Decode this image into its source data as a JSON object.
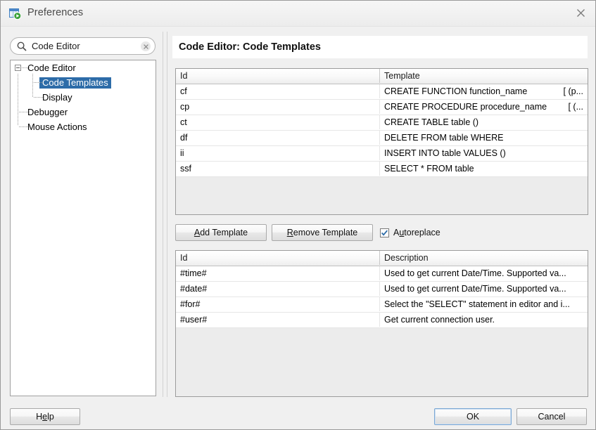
{
  "window": {
    "title": "Preferences",
    "icon": "table-run-icon",
    "close_label": "Close"
  },
  "sidebar": {
    "search": {
      "value": "Code Editor",
      "placeholder": "Search",
      "icon": "search-icon",
      "clear_icon": "clear-icon"
    },
    "tree": [
      {
        "label": "Code Editor",
        "level": 0,
        "expanded": true,
        "selected": false
      },
      {
        "label": "Code Templates",
        "level": 1,
        "expanded": false,
        "selected": true
      },
      {
        "label": "Display",
        "level": 1,
        "expanded": false,
        "selected": false
      },
      {
        "label": "Debugger",
        "level": 0,
        "expanded": false,
        "selected": false
      },
      {
        "label": "Mouse Actions",
        "level": 0,
        "expanded": false,
        "selected": false
      }
    ]
  },
  "main": {
    "heading": "Code Editor: Code Templates",
    "templates_table": {
      "columns": [
        "Id",
        "Template"
      ],
      "rows": [
        {
          "id": "cf",
          "template": "CREATE FUNCTION function_name",
          "tail": "[ (p..."
        },
        {
          "id": "cp",
          "template": "CREATE PROCEDURE procedure_name",
          "tail": "[ (..."
        },
        {
          "id": "ct",
          "template": "CREATE TABLE table ()",
          "tail": ""
        },
        {
          "id": "df",
          "template": "DELETE FROM table WHERE",
          "tail": ""
        },
        {
          "id": "ii",
          "template": "INSERT INTO table VALUES ()",
          "tail": ""
        },
        {
          "id": "ssf",
          "template": "SELECT * FROM table",
          "tail": ""
        }
      ]
    },
    "actions": {
      "add_template": {
        "pre": "",
        "mnemonic": "A",
        "post": "dd Template"
      },
      "remove_template": {
        "pre": "",
        "mnemonic": "R",
        "post": "emove Template"
      },
      "autoreplace": {
        "pre": "A",
        "mnemonic": "u",
        "post": "toreplace",
        "checked": true
      }
    },
    "variables_table": {
      "columns": [
        "Id",
        "Description"
      ],
      "rows": [
        {
          "id": "#time#",
          "description": "Used to get current Date/Time. Supported va..."
        },
        {
          "id": "#date#",
          "description": "Used to get current Date/Time. Supported va..."
        },
        {
          "id": "#for#",
          "description": "Select the \"SELECT\" statement in editor and i..."
        },
        {
          "id": "#user#",
          "description": "Get current connection user."
        }
      ]
    }
  },
  "footer": {
    "help": {
      "pre": "H",
      "mnemonic": "e",
      "post": "lp"
    },
    "ok": "OK",
    "cancel": "Cancel"
  },
  "colors": {
    "selection": "#2d6ca8",
    "dialog_bg": "#f0f0f0",
    "table_empty_bg": "#ececec",
    "focus_ring": "#7aa7d4",
    "accent_green": "#3aa13a",
    "accent_blue": "#4a86c8"
  }
}
